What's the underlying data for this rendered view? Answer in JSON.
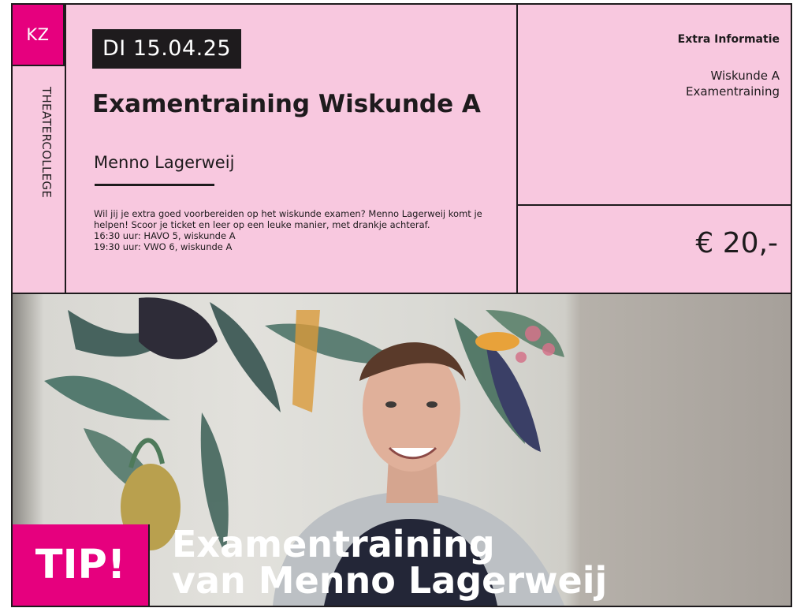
{
  "card": {
    "badge": "KZ",
    "venue": "THEATERCOLLEGE",
    "date": "DI 15.04.25",
    "title": "Examentraining Wiskunde A",
    "presenter": "Menno Lagerweij",
    "description": [
      "Wil jij je extra goed voorbereiden op het wiskunde examen? Menno Lagerweij komt je helpen! Scoor je ticket en leer op een leuke manier, met drankje achteraf.",
      "16:30 uur: HAVO 5, wiskunde A",
      "19:30 uur: VWO 6, wiskunde A"
    ],
    "info_title": "Extra Informatie",
    "info_lines": [
      "Wiskunde A",
      "Examentraining"
    ],
    "price": "€ 20,-"
  },
  "banner": {
    "tip_label": "TIP!",
    "headline": [
      "Examentraining",
      "van Menno Lagerweij"
    ]
  },
  "colors": {
    "accent": "#e6007e",
    "background": "#f8c8df",
    "ink": "#1e1b1d"
  }
}
